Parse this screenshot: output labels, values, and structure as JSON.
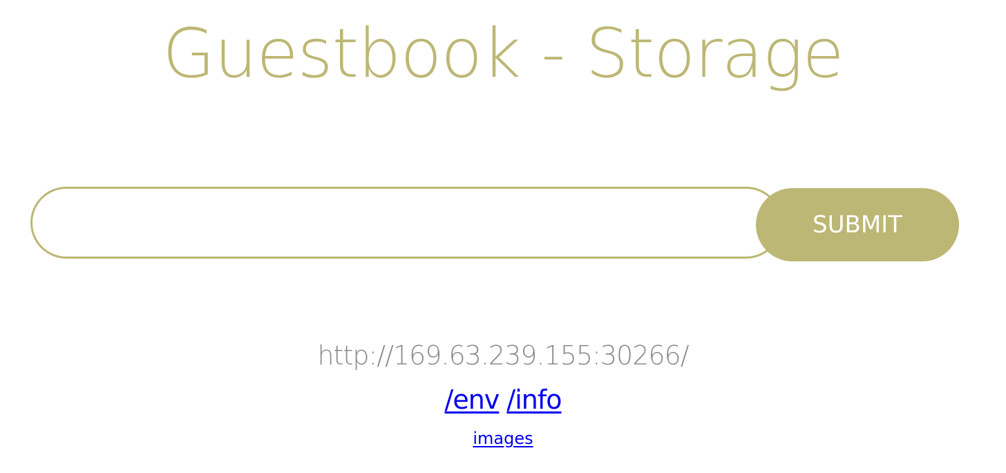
{
  "title": "Guestbook - Storage",
  "form": {
    "input_value": "",
    "input_placeholder": "",
    "submit_label": "SUBMIT"
  },
  "host": "http://169.63.239.155:30266/",
  "links": {
    "env": "/env",
    "info": "/info",
    "images": "images"
  },
  "colors": {
    "accent": "#bcb774",
    "host_text": "#8a8a8a",
    "link": "#0000ee",
    "background": "#ffffff"
  }
}
